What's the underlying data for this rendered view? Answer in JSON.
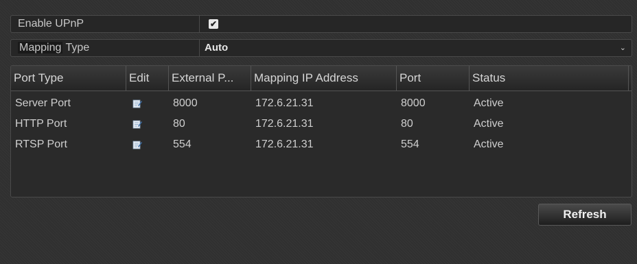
{
  "upnp": {
    "label": "Enable UPnP",
    "checked": true,
    "check_glyph": "✔"
  },
  "mapping_type": {
    "label_part1": "Mapping",
    "label_part2": " Type",
    "value": "Auto",
    "arrow": "⌄"
  },
  "table": {
    "headers": [
      "Port Type",
      "Edit",
      "External P...",
      "Mapping IP Address",
      "Port",
      "Status"
    ],
    "rows": [
      {
        "port_type": "Server Port",
        "edit_icon": "edit-icon",
        "external_port": "8000",
        "ip": "172.6.21.31",
        "port": "8000",
        "status": "Active"
      },
      {
        "port_type": "HTTP Port",
        "edit_icon": "edit-icon",
        "external_port": "80",
        "ip": "172.6.21.31",
        "port": "80",
        "status": "Active"
      },
      {
        "port_type": "RTSP Port",
        "edit_icon": "edit-icon",
        "external_port": "554",
        "ip": "172.6.21.31",
        "port": "554",
        "status": "Active"
      }
    ]
  },
  "refresh_label": "Refresh"
}
